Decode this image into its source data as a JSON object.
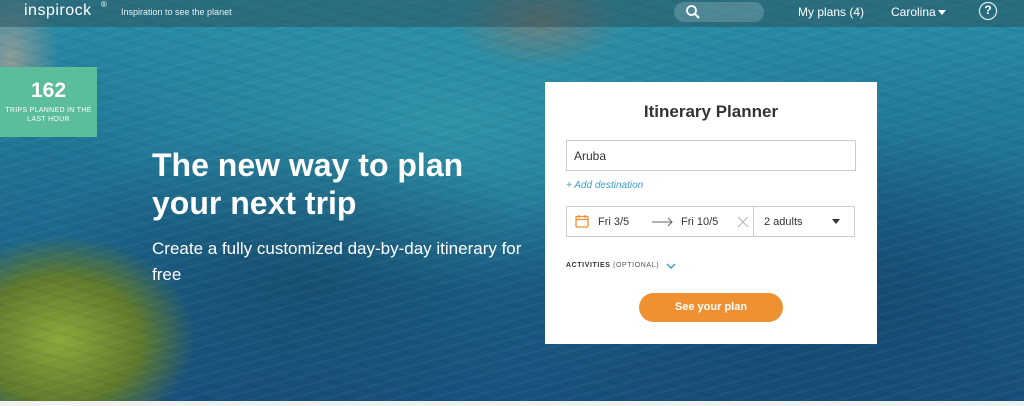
{
  "header": {
    "logo": "inspirock",
    "logo_mark": "®",
    "tagline": "Inspiration to see the planet",
    "my_plans": "My plans (4)",
    "user_name": "Carolina",
    "help": "?"
  },
  "stats": {
    "count": "162",
    "label": "TRIPS PLANNED IN THE LAST HOUR"
  },
  "hero": {
    "headline": "The new way to plan your next trip",
    "subhead": "Create a fully customized day-by-day itinerary for free"
  },
  "planner": {
    "title": "Itinerary Planner",
    "destination_value": "Aruba",
    "add_destination": "+ Add destination",
    "start_date": "Fri 3/5",
    "end_date": "Fri 10/5",
    "guests": "2 adults",
    "activities_label": "ACTIVITIES",
    "activities_optional": "(OPTIONAL)",
    "cta": "See your plan"
  },
  "colors": {
    "accent_green": "#5bbd9a",
    "cta_orange": "#ef9133",
    "link_blue": "#3aa0c8"
  }
}
